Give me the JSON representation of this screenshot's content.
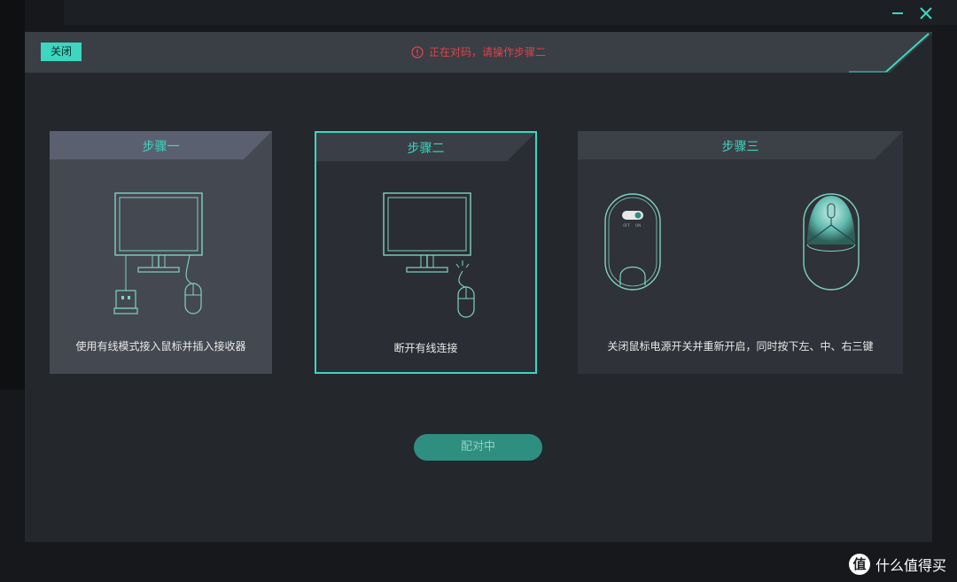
{
  "header": {
    "close_label": "关闭",
    "status_text": "正在对码，请操作步骤二",
    "status_color": "#e0434a",
    "accent_color": "#3dd6c0"
  },
  "steps": [
    {
      "title": "步骤一",
      "caption": "使用有线模式接入鼠标并插入接收器"
    },
    {
      "title": "步骤二",
      "caption": "断开有线连接"
    },
    {
      "title": "步骤三",
      "caption": "关闭鼠标电源开关并重新开启，同时按下左、中、右三键"
    }
  ],
  "mouse_switch": {
    "off": "OFF",
    "on": "ON"
  },
  "pair_button": {
    "label": "配对中"
  },
  "watermark": {
    "logo": "值",
    "text": "什么值得买"
  }
}
